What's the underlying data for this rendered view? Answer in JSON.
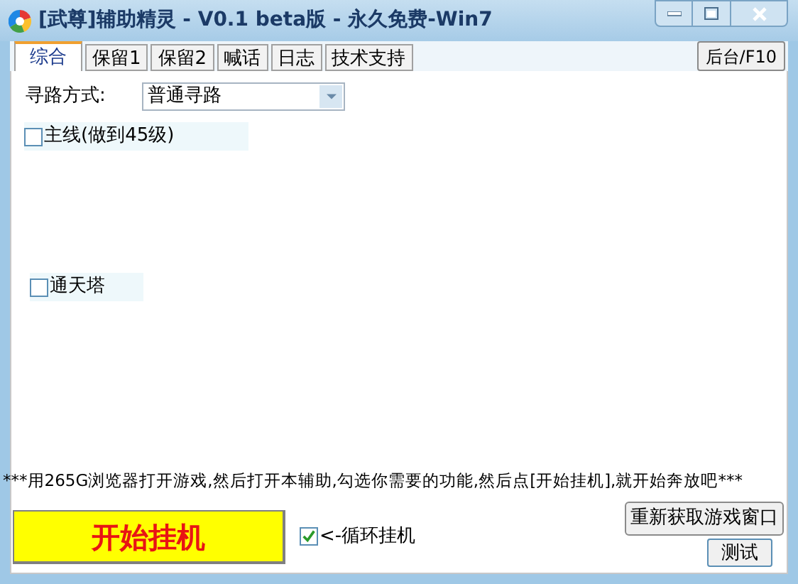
{
  "window": {
    "title": "[武尊]辅助精灵 - V0.1 beta版 - 永久免费-Win7"
  },
  "tabs": [
    {
      "label": "综合",
      "selected": true
    },
    {
      "label": "保留1",
      "selected": false
    },
    {
      "label": "保留2",
      "selected": false
    },
    {
      "label": "喊话",
      "selected": false
    },
    {
      "label": "日志",
      "selected": false
    },
    {
      "label": "技术支持",
      "selected": false
    }
  ],
  "background_button": "后台/F10",
  "pathfinding": {
    "label": "寻路方式:",
    "value": "普通寻路"
  },
  "options": [
    {
      "label": "主线(做到45级)",
      "checked": false
    },
    {
      "label": "通天塔",
      "checked": false
    }
  ],
  "instructions": "***用265G浏览器打开游戏,然后打开本辅助,勾选你需要的功能,然后点[开始挂机],就开始奔放吧***",
  "start_button": "开始挂机",
  "loop": {
    "label": "<-循环挂机",
    "checked": true
  },
  "buttons": [
    "重新获取游戏窗口",
    "测试"
  ]
}
